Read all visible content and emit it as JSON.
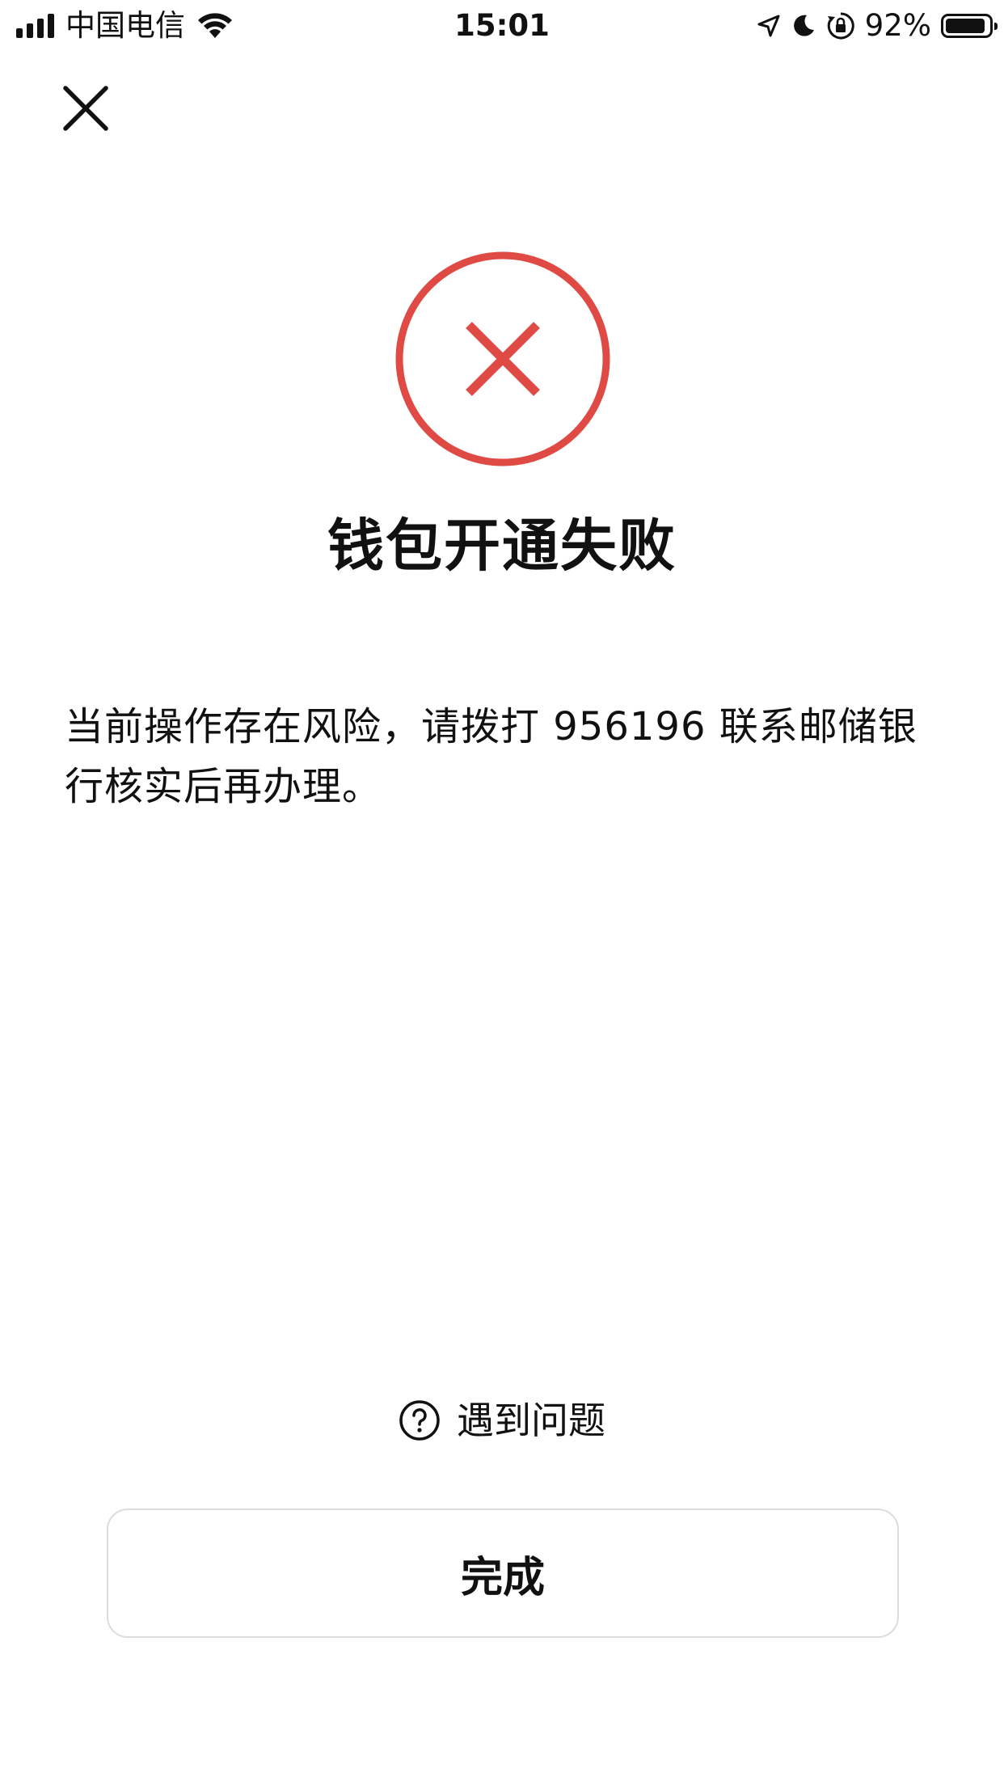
{
  "status_bar": {
    "carrier": "中国电信",
    "time": "15:01",
    "battery_percent_label": "92%",
    "battery_level": 0.92,
    "icons": [
      "signal-icon",
      "wifi-icon",
      "location-icon",
      "moon-icon",
      "rotation-lock-icon",
      "battery-icon"
    ]
  },
  "header": {
    "close_icon": "close-icon"
  },
  "result": {
    "icon": "fail-x-circle-icon",
    "icon_color": "#e04a45",
    "title": "钱包开通失败",
    "description": "当前操作存在风险，请拨打 956196 联系邮储银行核实后再办理。"
  },
  "help": {
    "icon": "question-circle-icon",
    "label": "遇到问题"
  },
  "actions": {
    "done_label": "完成"
  }
}
